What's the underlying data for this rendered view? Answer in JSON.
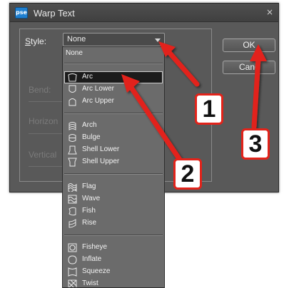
{
  "dialog": {
    "app_icon_text": "pse",
    "title": "Warp Text",
    "close_glyph": "×",
    "style_label_prefix": "",
    "style_label_accel": "S",
    "style_label_rest": "tyle:",
    "style_value": "None",
    "bend_label": "Bend:",
    "horizontal_label": "Horizon",
    "vertical_label": "Vertical",
    "ok_label": "OK",
    "cancel_label": "Canc"
  },
  "dropdown": {
    "items": [
      {
        "label": "None",
        "icon": "none"
      },
      {
        "label": "Arc",
        "icon": "arc-icon",
        "selected": true
      },
      {
        "label": "Arc Lower",
        "icon": "arc-lower-icon"
      },
      {
        "label": "Arc Upper",
        "icon": "arc-upper-icon"
      },
      {
        "label": "Arch",
        "icon": "arch-icon"
      },
      {
        "label": "Bulge",
        "icon": "bulge-icon"
      },
      {
        "label": "Shell Lower",
        "icon": "shell-lower-icon"
      },
      {
        "label": "Shell Upper",
        "icon": "shell-upper-icon"
      },
      {
        "label": "Flag",
        "icon": "flag-icon"
      },
      {
        "label": "Wave",
        "icon": "wave-icon"
      },
      {
        "label": "Fish",
        "icon": "fish-icon"
      },
      {
        "label": "Rise",
        "icon": "rise-icon"
      },
      {
        "label": "Fisheye",
        "icon": "fisheye-icon"
      },
      {
        "label": "Inflate",
        "icon": "inflate-icon"
      },
      {
        "label": "Squeeze",
        "icon": "squeeze-icon"
      },
      {
        "label": "Twist",
        "icon": "twist-icon"
      }
    ]
  },
  "annotations": {
    "callout_1": "1",
    "callout_2": "2",
    "callout_3": "3",
    "arrow_color": "#e2231a"
  },
  "colors": {
    "dialog_bg": "#595959",
    "dropdown_bg": "#6b6b6b",
    "selected_bg": "#1b1b1b",
    "app_icon_blue": "#1e7fd0"
  }
}
